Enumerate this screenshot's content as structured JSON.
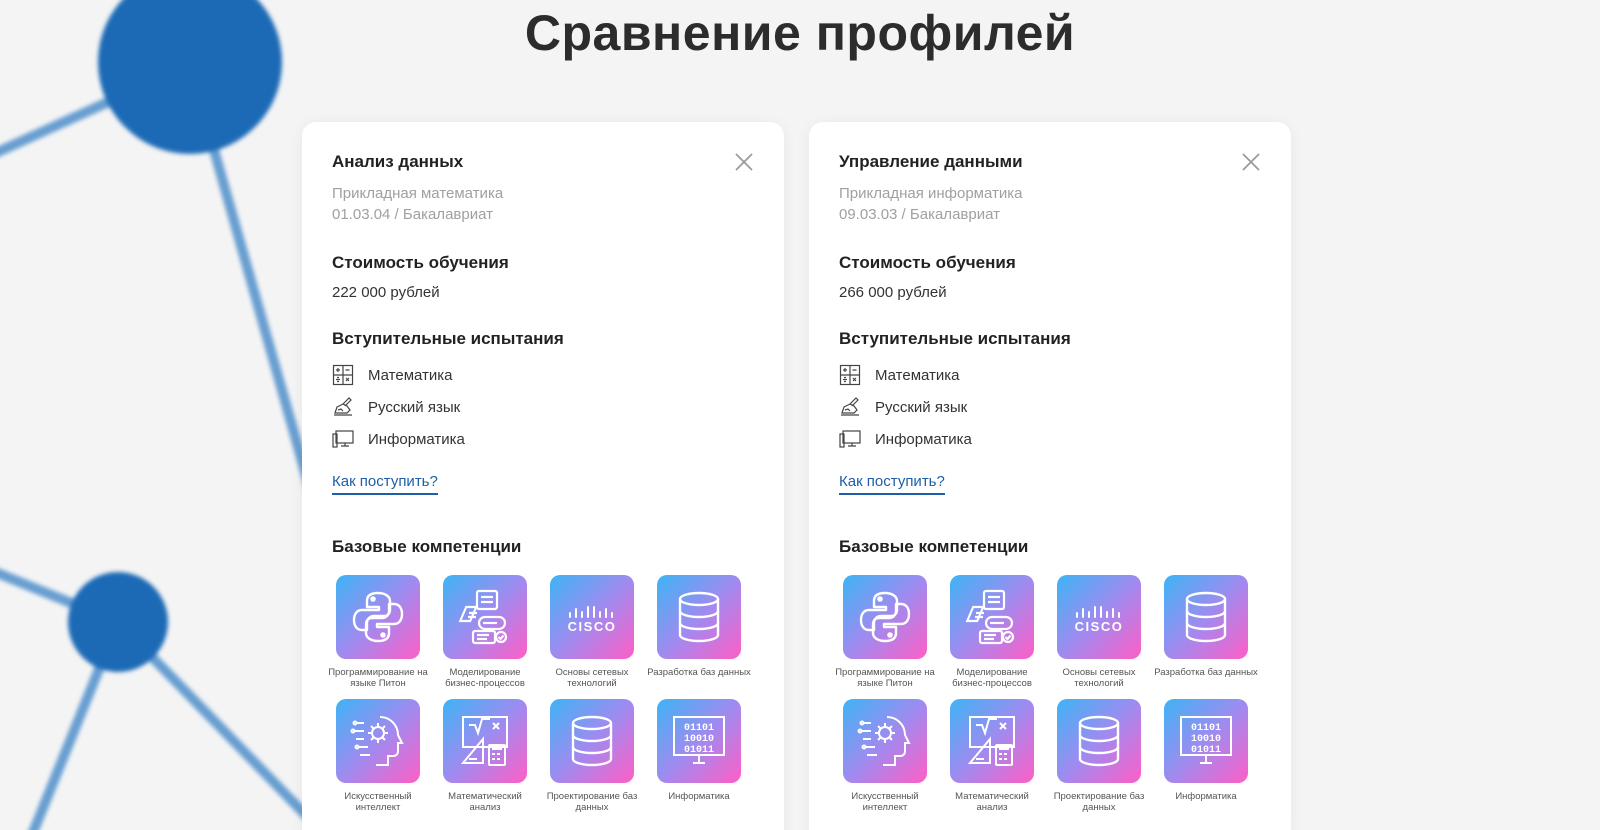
{
  "page": {
    "title": "Сравнение профилей"
  },
  "colors": {
    "accent_link": "#1d5fa8",
    "tile_gradient": [
      "#3db4f5",
      "#9f8bf0",
      "#ff5ec6"
    ],
    "background_molecule": "#1a6bb6"
  },
  "cards": [
    {
      "name": "Анализ данных",
      "direction": "Прикладная математика",
      "code_level": "01.03.04 / Бакалавриат",
      "cost_title": "Стоимость обучения",
      "cost_value": "222 000 рублей",
      "exams_title": "Вступительные испытания",
      "exams": [
        {
          "label": "Математика",
          "icon": "calculator-icon"
        },
        {
          "label": "Русский язык",
          "icon": "writing-hand-icon"
        },
        {
          "label": "Информатика",
          "icon": "computer-icon"
        }
      ],
      "how_link": "Как поступить?",
      "competencies_title": "Базовые компетенции",
      "competencies": [
        {
          "label": "Программирование на языке Питон",
          "icon": "python-icon"
        },
        {
          "label": "Моделирование бизнес-процессов",
          "icon": "process-icon"
        },
        {
          "label": "Основы сетевых технологий",
          "icon": "cisco-icon"
        },
        {
          "label": "Разработка баз данных",
          "icon": "database-icon"
        },
        {
          "label": "Искусственный интеллект",
          "icon": "ai-head-icon"
        },
        {
          "label": "Математический анализ",
          "icon": "math-board-icon"
        },
        {
          "label": "Проектирование баз данных",
          "icon": "database-icon"
        },
        {
          "label": "Информатика",
          "icon": "binary-monitor-icon"
        }
      ]
    },
    {
      "name": "Управление данными",
      "direction": "Прикладная информатика",
      "code_level": "09.03.03 / Бакалавриат",
      "cost_title": "Стоимость обучения",
      "cost_value": "266 000 рублей",
      "exams_title": "Вступительные испытания",
      "exams": [
        {
          "label": "Математика",
          "icon": "calculator-icon"
        },
        {
          "label": "Русский язык",
          "icon": "writing-hand-icon"
        },
        {
          "label": "Информатика",
          "icon": "computer-icon"
        }
      ],
      "how_link": "Как поступить?",
      "competencies_title": "Базовые компетенции",
      "competencies": [
        {
          "label": "Программирование на языке Питон",
          "icon": "python-icon"
        },
        {
          "label": "Моделирование бизнес-процессов",
          "icon": "process-icon"
        },
        {
          "label": "Основы сетевых технологий",
          "icon": "cisco-icon"
        },
        {
          "label": "Разработка баз данных",
          "icon": "database-icon"
        },
        {
          "label": "Искусственный интеллект",
          "icon": "ai-head-icon"
        },
        {
          "label": "Математический анализ",
          "icon": "math-board-icon"
        },
        {
          "label": "Проектирование баз данных",
          "icon": "database-icon"
        },
        {
          "label": "Информатика",
          "icon": "binary-monitor-icon"
        }
      ]
    }
  ]
}
